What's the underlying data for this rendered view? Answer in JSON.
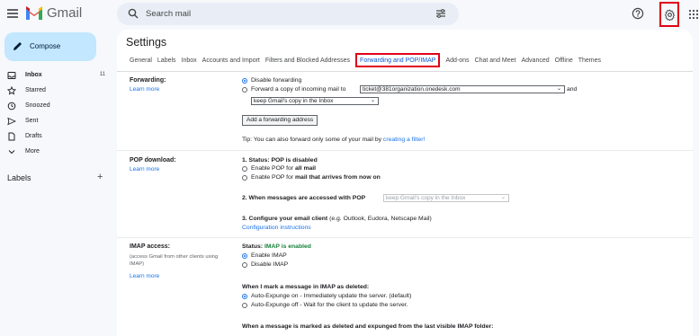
{
  "app": {
    "name": "Gmail"
  },
  "search": {
    "placeholder": "Search mail"
  },
  "sidebar": {
    "compose_label": "Compose",
    "items": [
      {
        "label": "Inbox",
        "count": "11",
        "icon": "inbox-icon"
      },
      {
        "label": "Starred",
        "icon": "star-icon"
      },
      {
        "label": "Snoozed",
        "icon": "clock-icon"
      },
      {
        "label": "Sent",
        "icon": "send-icon"
      },
      {
        "label": "Drafts",
        "icon": "draft-icon"
      },
      {
        "label": "More",
        "icon": "chevron-down-icon"
      }
    ],
    "labels_header": "Labels",
    "labels_add": "+"
  },
  "settings": {
    "title": "Settings",
    "tabs": [
      "General",
      "Labels",
      "Inbox",
      "Accounts and Import",
      "Filters and Blocked Addresses",
      "Forwarding and POP/IMAP",
      "Add-ons",
      "Chat and Meet",
      "Advanced",
      "Offline",
      "Themes"
    ],
    "active_tab": "Forwarding and POP/IMAP"
  },
  "forwarding": {
    "title": "Forwarding:",
    "learn_more": "Learn more",
    "disable_label": "Disable forwarding",
    "forward_label": "Forward a copy of incoming mail to",
    "forward_address": "ticket@381organization.onedesk.com",
    "and": "and",
    "copy_option": "keep Gmail's copy in the Inbox",
    "add_button": "Add a forwarding address",
    "tip_prefix": "Tip: You can also forward only some of your mail by ",
    "tip_link": "creating a filter!"
  },
  "pop": {
    "title": "POP download:",
    "learn_more": "Learn more",
    "status_prefix": "1. Status: ",
    "status_value": "POP is disabled",
    "opt1_prefix": "Enable POP for ",
    "opt1_bold": "all mail",
    "opt2_prefix": "Enable POP for ",
    "opt2_bold": "mail that arrives from now on",
    "step2_label": "2. When messages are accessed with POP",
    "step2_option": "keep Gmail's copy in the Inbox",
    "step3_label": "3. Configure your email client",
    "step3_hint": " (e.g. Outlook, Eudora, Netscape Mail)",
    "config_link": "Configuration instructions"
  },
  "imap": {
    "title": "IMAP access:",
    "note": "(access Gmail from other clients using IMAP)",
    "learn_more": "Learn more",
    "status_prefix": "Status: ",
    "status_value": "IMAP is enabled",
    "enable_label": "Enable IMAP",
    "disable_label": "Disable IMAP",
    "deleted_heading": "When I mark a message in IMAP as deleted:",
    "expunge_on": "Auto-Expunge on - Immediately update the server. (default)",
    "expunge_off": "Auto-Expunge off - Wait for the client to update the server.",
    "expunged_heading": "When a message is marked as deleted and expunged from the last visible IMAP folder:"
  },
  "colors": {
    "accent": "#1a73e8",
    "highlight_box": "#e0001a",
    "status_green": "#188038",
    "compose_bg": "#c2e7ff"
  }
}
